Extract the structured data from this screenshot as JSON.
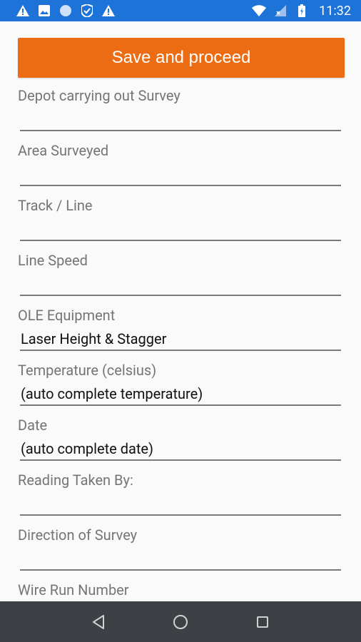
{
  "status_bar": {
    "time": "11:32",
    "left_icons": [
      "warning-icon",
      "image-icon",
      "circle-icon",
      "shield-icon",
      "warning-icon"
    ],
    "right_icons": [
      "wifi-icon",
      "signal-icon",
      "battery-icon"
    ]
  },
  "colors": {
    "status_bar": "#1e73d8",
    "accent": "#ec6c13",
    "nav_bar": "#3d4145"
  },
  "form": {
    "save_label": "Save and proceed",
    "fields": [
      {
        "label": "Depot carrying out Survey",
        "value": ""
      },
      {
        "label": "Area Surveyed",
        "value": ""
      },
      {
        "label": "Track / Line",
        "value": ""
      },
      {
        "label": "Line Speed",
        "value": ""
      },
      {
        "label": "OLE Equipment",
        "value": "Laser Height & Stagger"
      },
      {
        "label": "Temperature (celsius)",
        "value": "(auto complete temperature)"
      },
      {
        "label": "Date",
        "value": "(auto complete date)"
      },
      {
        "label": "Reading Taken By:",
        "value": ""
      },
      {
        "label": "Direction of Survey",
        "value": ""
      },
      {
        "label": "Wire Run Number",
        "value": ""
      }
    ]
  },
  "nav": {
    "icons": [
      "back-icon",
      "home-icon",
      "recents-icon"
    ]
  }
}
